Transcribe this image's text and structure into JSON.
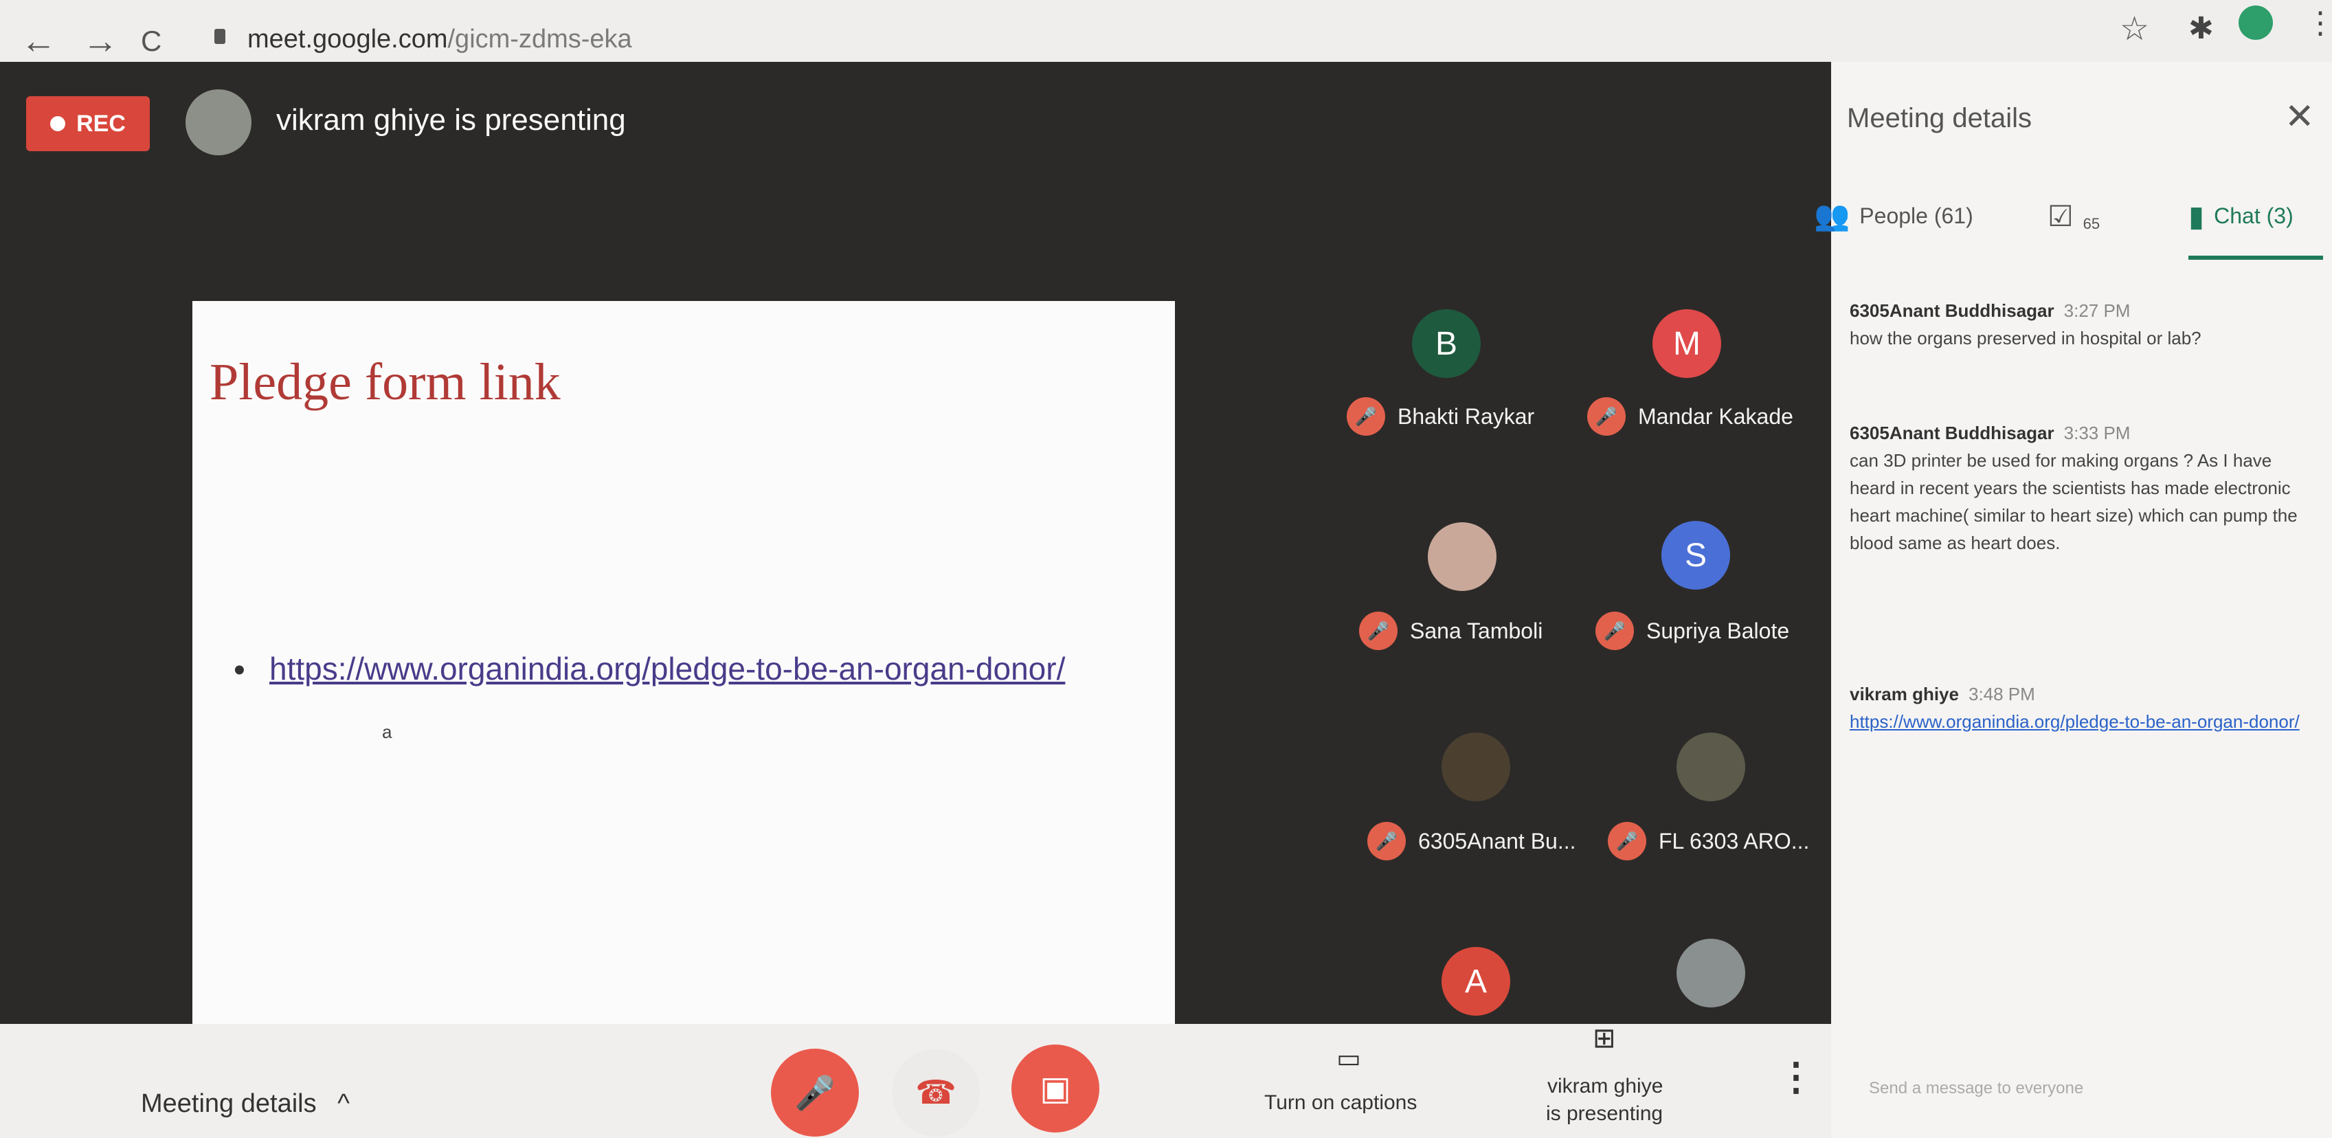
{
  "browser": {
    "back": "←",
    "forward": "→",
    "reload": "C",
    "url_host": "meet.google.com",
    "url_path": "/gicm-zdms-eka"
  },
  "meeting": {
    "rec_label": "REC",
    "presenter_text": "vikram ghiye is presenting"
  },
  "slide": {
    "title": "Pledge form link",
    "bullet": "•",
    "link": "https://www.organindia.org/pledge-to-be-an-organ-donor/",
    "mark": "a"
  },
  "participants": [
    {
      "initial": "B",
      "name": "Bhakti Raykar",
      "color": "#1e5a3e"
    },
    {
      "initial": "M",
      "name": "Mandar Kakade",
      "color": "#e04a4a"
    },
    {
      "initial": "",
      "name": "Sana Tamboli",
      "color": "#c9a89a"
    },
    {
      "initial": "S",
      "name": "Supriya Balote",
      "color": "#4a6fd6"
    },
    {
      "initial": "",
      "name": "6305Anant Bu...",
      "color": "#4b4030"
    },
    {
      "initial": "",
      "name": "FL 6303 ARO...",
      "color": "#5c5a4a"
    },
    {
      "initial": "A",
      "name": "",
      "color": "#d9493b"
    },
    {
      "initial": "",
      "name": "",
      "color": "#8a9090"
    }
  ],
  "bottom": {
    "meeting_details": "Meeting details",
    "chevron": "^",
    "captions_label": "Turn on captions",
    "present_label_1": "vikram ghiye",
    "present_label_2": "is presenting",
    "more": "⋮"
  },
  "panel": {
    "title": "Meeting details",
    "close": "✕",
    "tabs": [
      {
        "label": "People (61)"
      },
      {
        "label": "65"
      },
      {
        "label": "Chat (3)"
      }
    ],
    "messages": [
      {
        "sender": "6305Anant Buddhisagar",
        "time": "3:27 PM",
        "text": "how the organs preserved in hospital or lab?"
      },
      {
        "sender": "6305Anant Buddhisagar",
        "time": "3:33 PM",
        "text": "can 3D printer be used for making organs ? As I have heard in recent years the scientists has made electronic heart machine( similar to heart size) which can pump the blood same as heart does."
      },
      {
        "sender": "vikram ghiye",
        "time": "3:48 PM",
        "text": "https://www.organindia.org/pledge-to-be-an-organ-donor/"
      }
    ],
    "input_placeholder": "Send a message to everyone"
  },
  "colors": {
    "accent": "#1f7a5b",
    "rec": "#d9463b",
    "danger": "#e25a4a"
  }
}
